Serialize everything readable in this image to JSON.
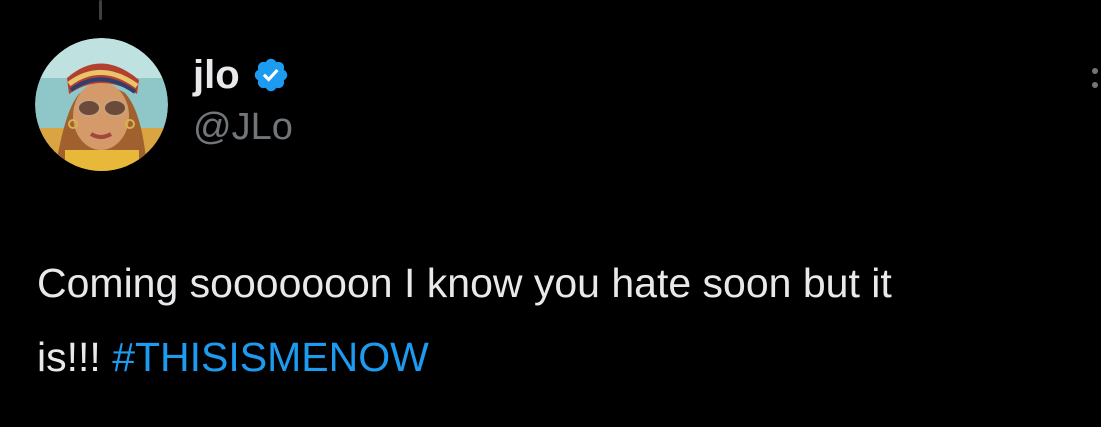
{
  "tweet": {
    "display_name": "jlo",
    "handle": "@JLo",
    "verified": true,
    "text_line1": "Coming sooooooon I know you hate soon but it",
    "text_line2": "is!!! ",
    "hashtag": "#THISISMENOW"
  },
  "icons": {
    "verified": "verified-badge-icon",
    "more": "more-options-icon"
  },
  "colors": {
    "background": "#000000",
    "text": "#e7e9ea",
    "secondary_text": "#71767b",
    "link": "#1d9bf0",
    "verified_badge": "#1d9bf0"
  }
}
